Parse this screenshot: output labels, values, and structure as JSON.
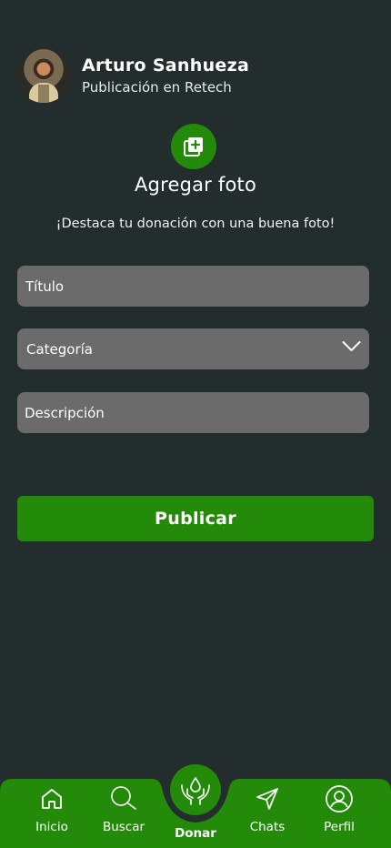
{
  "user": {
    "name": "Arturo Sanhueza",
    "subtitle": "Publicación en Retech"
  },
  "photo": {
    "title": "Agregar foto",
    "hint": "¡Destaca tu donación con una buena foto!",
    "icon": "add-photo-icon"
  },
  "form": {
    "title_placeholder": "Título",
    "category_placeholder": "Categoría",
    "description_placeholder": "Descripción",
    "submit_label": "Publicar"
  },
  "nav": {
    "items": [
      {
        "label": "Inicio",
        "icon": "home-icon"
      },
      {
        "label": "Buscar",
        "icon": "search-icon"
      },
      {
        "label": "Donar",
        "icon": "donate-hands-icon"
      },
      {
        "label": "Chats",
        "icon": "send-icon"
      },
      {
        "label": "Perfil",
        "icon": "profile-icon"
      }
    ]
  },
  "colors": {
    "background": "#232d2e",
    "accent": "#238a0a",
    "field": "#6b6b6b"
  }
}
